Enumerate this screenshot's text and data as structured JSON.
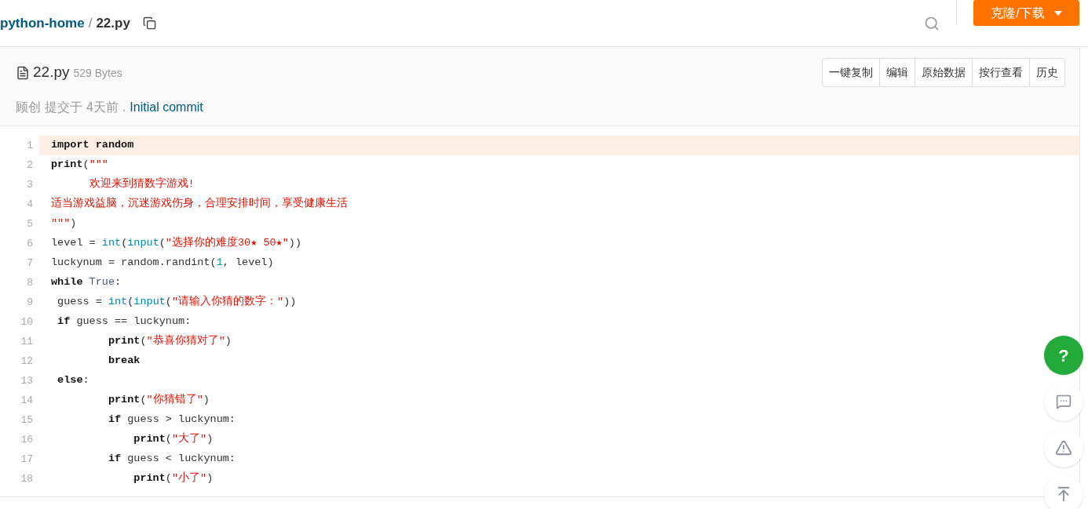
{
  "breadcrumb": {
    "repo": "python-home",
    "separator": "/",
    "file": "22.py"
  },
  "clone_button": {
    "label": "克隆/下载"
  },
  "file_header": {
    "name": "22.py",
    "size": "529 Bytes",
    "author": "顾创",
    "action": "提交于",
    "time": "4天前",
    "separator": ".",
    "commit": "Initial commit"
  },
  "actions": [
    "一键复制",
    "编辑",
    "原始数据",
    "按行查看",
    "历史"
  ],
  "code": [
    {
      "number": "1",
      "selected": true,
      "tokens": [
        {
          "kind": "kw",
          "text": "import"
        },
        {
          "kind": "kw",
          "text": " random"
        }
      ]
    },
    {
      "number": "2",
      "selected": false,
      "tokens": [
        {
          "kind": "kw",
          "text": "print"
        },
        {
          "kind": "plain",
          "text": "("
        },
        {
          "kind": "str",
          "text": "\"\"\""
        }
      ]
    },
    {
      "number": "3",
      "selected": false,
      "tokens": [
        {
          "kind": "str",
          "text": "      欢迎来到猜数字游戏!"
        }
      ]
    },
    {
      "number": "4",
      "selected": false,
      "tokens": [
        {
          "kind": "str",
          "text": "适当游戏益脑，沉迷游戏伤身，合理安排时间，享受健康生活"
        }
      ]
    },
    {
      "number": "5",
      "selected": false,
      "tokens": [
        {
          "kind": "str",
          "text": "\"\"\""
        },
        {
          "kind": "plain",
          "text": ")"
        }
      ]
    },
    {
      "number": "6",
      "selected": false,
      "tokens": [
        {
          "kind": "plain",
          "text": "level = "
        },
        {
          "kind": "builtin",
          "text": "int"
        },
        {
          "kind": "plain",
          "text": "("
        },
        {
          "kind": "builtin",
          "text": "input"
        },
        {
          "kind": "plain",
          "text": "("
        },
        {
          "kind": "str",
          "text": "\"选择你的难度30★ 50★\""
        },
        {
          "kind": "plain",
          "text": "))"
        }
      ]
    },
    {
      "number": "7",
      "selected": false,
      "tokens": [
        {
          "kind": "plain",
          "text": "luckynum = random.randint("
        },
        {
          "kind": "num",
          "text": "1"
        },
        {
          "kind": "plain",
          "text": ", level)"
        }
      ]
    },
    {
      "number": "8",
      "selected": false,
      "tokens": [
        {
          "kind": "kw",
          "text": "while"
        },
        {
          "kind": "const",
          "text": " True"
        },
        {
          "kind": "plain",
          "text": ":"
        }
      ]
    },
    {
      "number": "9",
      "selected": false,
      "tokens": [
        {
          "kind": "plain",
          "text": " guess = "
        },
        {
          "kind": "builtin",
          "text": "int"
        },
        {
          "kind": "plain",
          "text": "("
        },
        {
          "kind": "builtin",
          "text": "input"
        },
        {
          "kind": "plain",
          "text": "("
        },
        {
          "kind": "str",
          "text": "\"请输入你猜的数字：\""
        },
        {
          "kind": "plain",
          "text": "))"
        }
      ]
    },
    {
      "number": "10",
      "selected": false,
      "tokens": [
        {
          "kind": "kw",
          "text": " if"
        },
        {
          "kind": "plain",
          "text": " guess == luckynum:"
        }
      ]
    },
    {
      "number": "11",
      "selected": false,
      "tokens": [
        {
          "kind": "kw",
          "text": "         print"
        },
        {
          "kind": "plain",
          "text": "("
        },
        {
          "kind": "str",
          "text": "\"恭喜你猜对了\""
        },
        {
          "kind": "plain",
          "text": ")"
        }
      ]
    },
    {
      "number": "12",
      "selected": false,
      "tokens": [
        {
          "kind": "kw",
          "text": "         break"
        }
      ]
    },
    {
      "number": "13",
      "selected": false,
      "tokens": [
        {
          "kind": "kw",
          "text": " else"
        },
        {
          "kind": "plain",
          "text": ":"
        }
      ]
    },
    {
      "number": "14",
      "selected": false,
      "tokens": [
        {
          "kind": "kw",
          "text": "         print"
        },
        {
          "kind": "plain",
          "text": "("
        },
        {
          "kind": "str",
          "text": "\"你猜错了\""
        },
        {
          "kind": "plain",
          "text": ")"
        }
      ]
    },
    {
      "number": "15",
      "selected": false,
      "tokens": [
        {
          "kind": "kw",
          "text": "         if"
        },
        {
          "kind": "plain",
          "text": " guess > luckynum:"
        }
      ]
    },
    {
      "number": "16",
      "selected": false,
      "tokens": [
        {
          "kind": "kw",
          "text": "             print"
        },
        {
          "kind": "plain",
          "text": "("
        },
        {
          "kind": "str",
          "text": "\"大了\""
        },
        {
          "kind": "plain",
          "text": ")"
        }
      ]
    },
    {
      "number": "17",
      "selected": false,
      "tokens": [
        {
          "kind": "kw",
          "text": "         if"
        },
        {
          "kind": "plain",
          "text": " guess < luckynum:"
        }
      ]
    },
    {
      "number": "18",
      "selected": false,
      "tokens": [
        {
          "kind": "kw",
          "text": "             print"
        },
        {
          "kind": "plain",
          "text": "("
        },
        {
          "kind": "str",
          "text": "\"小了\""
        },
        {
          "kind": "plain",
          "text": ")"
        }
      ]
    }
  ],
  "help_button": {
    "label": "?"
  }
}
